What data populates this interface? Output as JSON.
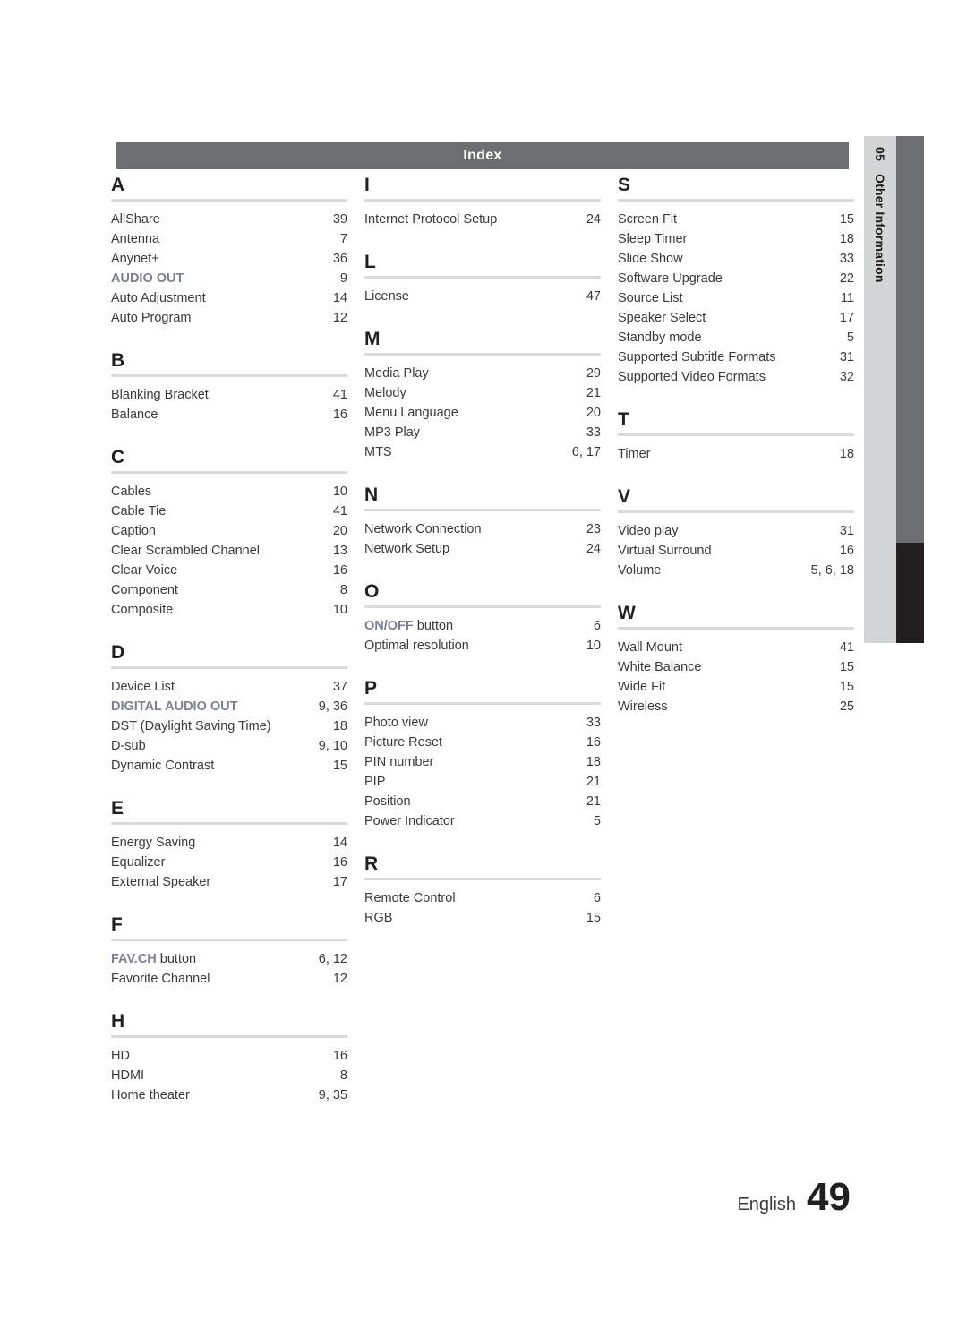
{
  "header": {
    "title": "Index"
  },
  "side_tab": {
    "number": "05",
    "label": "Other Information"
  },
  "footer": {
    "language": "English",
    "page_number": "49"
  },
  "columns": [
    {
      "groups": [
        {
          "letter": "A",
          "entries": [
            {
              "term": "AllShare",
              "accent": "",
              "page": "39"
            },
            {
              "term": "Antenna",
              "accent": "",
              "page": "7"
            },
            {
              "term": "Anynet+",
              "accent": "",
              "page": "36"
            },
            {
              "term": "",
              "accent": "AUDIO OUT",
              "page": "9"
            },
            {
              "term": "Auto Adjustment",
              "accent": "",
              "page": "14"
            },
            {
              "term": "Auto Program",
              "accent": "",
              "page": "12"
            }
          ]
        },
        {
          "letter": "B",
          "entries": [
            {
              "term": "Blanking Bracket",
              "accent": "",
              "page": "41"
            },
            {
              "term": "Balance",
              "accent": "",
              "page": "16"
            }
          ]
        },
        {
          "letter": "C",
          "entries": [
            {
              "term": "Cables",
              "accent": "",
              "page": "10"
            },
            {
              "term": "Cable Tie",
              "accent": "",
              "page": "41"
            },
            {
              "term": "Caption",
              "accent": "",
              "page": "20"
            },
            {
              "term": "Clear Scrambled Channel",
              "accent": "",
              "page": "13"
            },
            {
              "term": "Clear Voice",
              "accent": "",
              "page": "16"
            },
            {
              "term": "Component",
              "accent": "",
              "page": "8"
            },
            {
              "term": "Composite",
              "accent": "",
              "page": "10"
            }
          ]
        },
        {
          "letter": "D",
          "entries": [
            {
              "term": "Device List",
              "accent": "",
              "page": "37"
            },
            {
              "term": "",
              "accent": "DIGITAL AUDIO OUT",
              "page": "9, 36"
            },
            {
              "term": "DST (Daylight Saving Time)",
              "accent": "",
              "page": "18"
            },
            {
              "term": "D-sub",
              "accent": "",
              "page": "9, 10"
            },
            {
              "term": "Dynamic Contrast",
              "accent": "",
              "page": "15"
            }
          ]
        },
        {
          "letter": "E",
          "entries": [
            {
              "term": "Energy Saving",
              "accent": "",
              "page": "14"
            },
            {
              "term": "Equalizer",
              "accent": "",
              "page": "16"
            },
            {
              "term": "External Speaker",
              "accent": "",
              "page": "17"
            }
          ]
        },
        {
          "letter": "F",
          "entries": [
            {
              "term": " button",
              "accent": "FAV.CH",
              "page": "6, 12"
            },
            {
              "term": "Favorite Channel",
              "accent": "",
              "page": "12"
            }
          ]
        },
        {
          "letter": "H",
          "entries": [
            {
              "term": "HD",
              "accent": "",
              "page": "16"
            },
            {
              "term": "HDMI",
              "accent": "",
              "page": "8"
            },
            {
              "term": "Home theater",
              "accent": "",
              "page": "9, 35"
            }
          ]
        }
      ]
    },
    {
      "groups": [
        {
          "letter": "I",
          "entries": [
            {
              "term": "Internet Protocol Setup",
              "accent": "",
              "page": "24"
            }
          ]
        },
        {
          "letter": "L",
          "entries": [
            {
              "term": "License",
              "accent": "",
              "page": "47"
            }
          ]
        },
        {
          "letter": "M",
          "entries": [
            {
              "term": "Media Play",
              "accent": "",
              "page": "29"
            },
            {
              "term": "Melody",
              "accent": "",
              "page": "21"
            },
            {
              "term": "Menu Language",
              "accent": "",
              "page": "20"
            },
            {
              "term": "MP3 Play",
              "accent": "",
              "page": "33"
            },
            {
              "term": "MTS",
              "accent": "",
              "page": "6, 17"
            }
          ]
        },
        {
          "letter": "N",
          "entries": [
            {
              "term": "Network Connection",
              "accent": "",
              "page": "23"
            },
            {
              "term": "Network Setup",
              "accent": "",
              "page": "24"
            }
          ]
        },
        {
          "letter": "O",
          "entries": [
            {
              "term": " button",
              "accent": "ON/OFF",
              "page": "6"
            },
            {
              "term": "Optimal resolution",
              "accent": "",
              "page": "10"
            }
          ]
        },
        {
          "letter": "P",
          "entries": [
            {
              "term": "Photo view",
              "accent": "",
              "page": "33"
            },
            {
              "term": "Picture Reset",
              "accent": "",
              "page": "16"
            },
            {
              "term": "PIN number",
              "accent": "",
              "page": "18"
            },
            {
              "term": "PIP",
              "accent": "",
              "page": "21"
            },
            {
              "term": "Position",
              "accent": "",
              "page": "21"
            },
            {
              "term": "Power Indicator",
              "accent": "",
              "page": "5"
            }
          ]
        },
        {
          "letter": "R",
          "entries": [
            {
              "term": "Remote Control",
              "accent": "",
              "page": "6"
            },
            {
              "term": "RGB",
              "accent": "",
              "page": "15"
            }
          ]
        }
      ]
    },
    {
      "groups": [
        {
          "letter": "S",
          "entries": [
            {
              "term": "Screen Fit",
              "accent": "",
              "page": "15"
            },
            {
              "term": "Sleep Timer",
              "accent": "",
              "page": "18"
            },
            {
              "term": "Slide Show",
              "accent": "",
              "page": "33"
            },
            {
              "term": "Software Upgrade",
              "accent": "",
              "page": "22"
            },
            {
              "term": "Source List",
              "accent": "",
              "page": "11"
            },
            {
              "term": "Speaker Select",
              "accent": "",
              "page": "17"
            },
            {
              "term": "Standby mode",
              "accent": "",
              "page": "5"
            },
            {
              "term": "Supported Subtitle Formats",
              "accent": "",
              "page": "31"
            },
            {
              "term": "Supported Video Formats",
              "accent": "",
              "page": "32"
            }
          ]
        },
        {
          "letter": "T",
          "entries": [
            {
              "term": "Timer",
              "accent": "",
              "page": "18"
            }
          ]
        },
        {
          "letter": "V",
          "entries": [
            {
              "term": "Video play",
              "accent": "",
              "page": "31"
            },
            {
              "term": "Virtual Surround",
              "accent": "",
              "page": "16"
            },
            {
              "term": "Volume",
              "accent": "",
              "page": "5, 6, 18"
            }
          ]
        },
        {
          "letter": "W",
          "entries": [
            {
              "term": "Wall Mount",
              "accent": "",
              "page": "41"
            },
            {
              "term": "White Balance",
              "accent": "",
              "page": "15"
            },
            {
              "term": "Wide Fit",
              "accent": "",
              "page": "15"
            },
            {
              "term": "Wireless",
              "accent": "",
              "page": "25"
            }
          ]
        }
      ]
    }
  ]
}
